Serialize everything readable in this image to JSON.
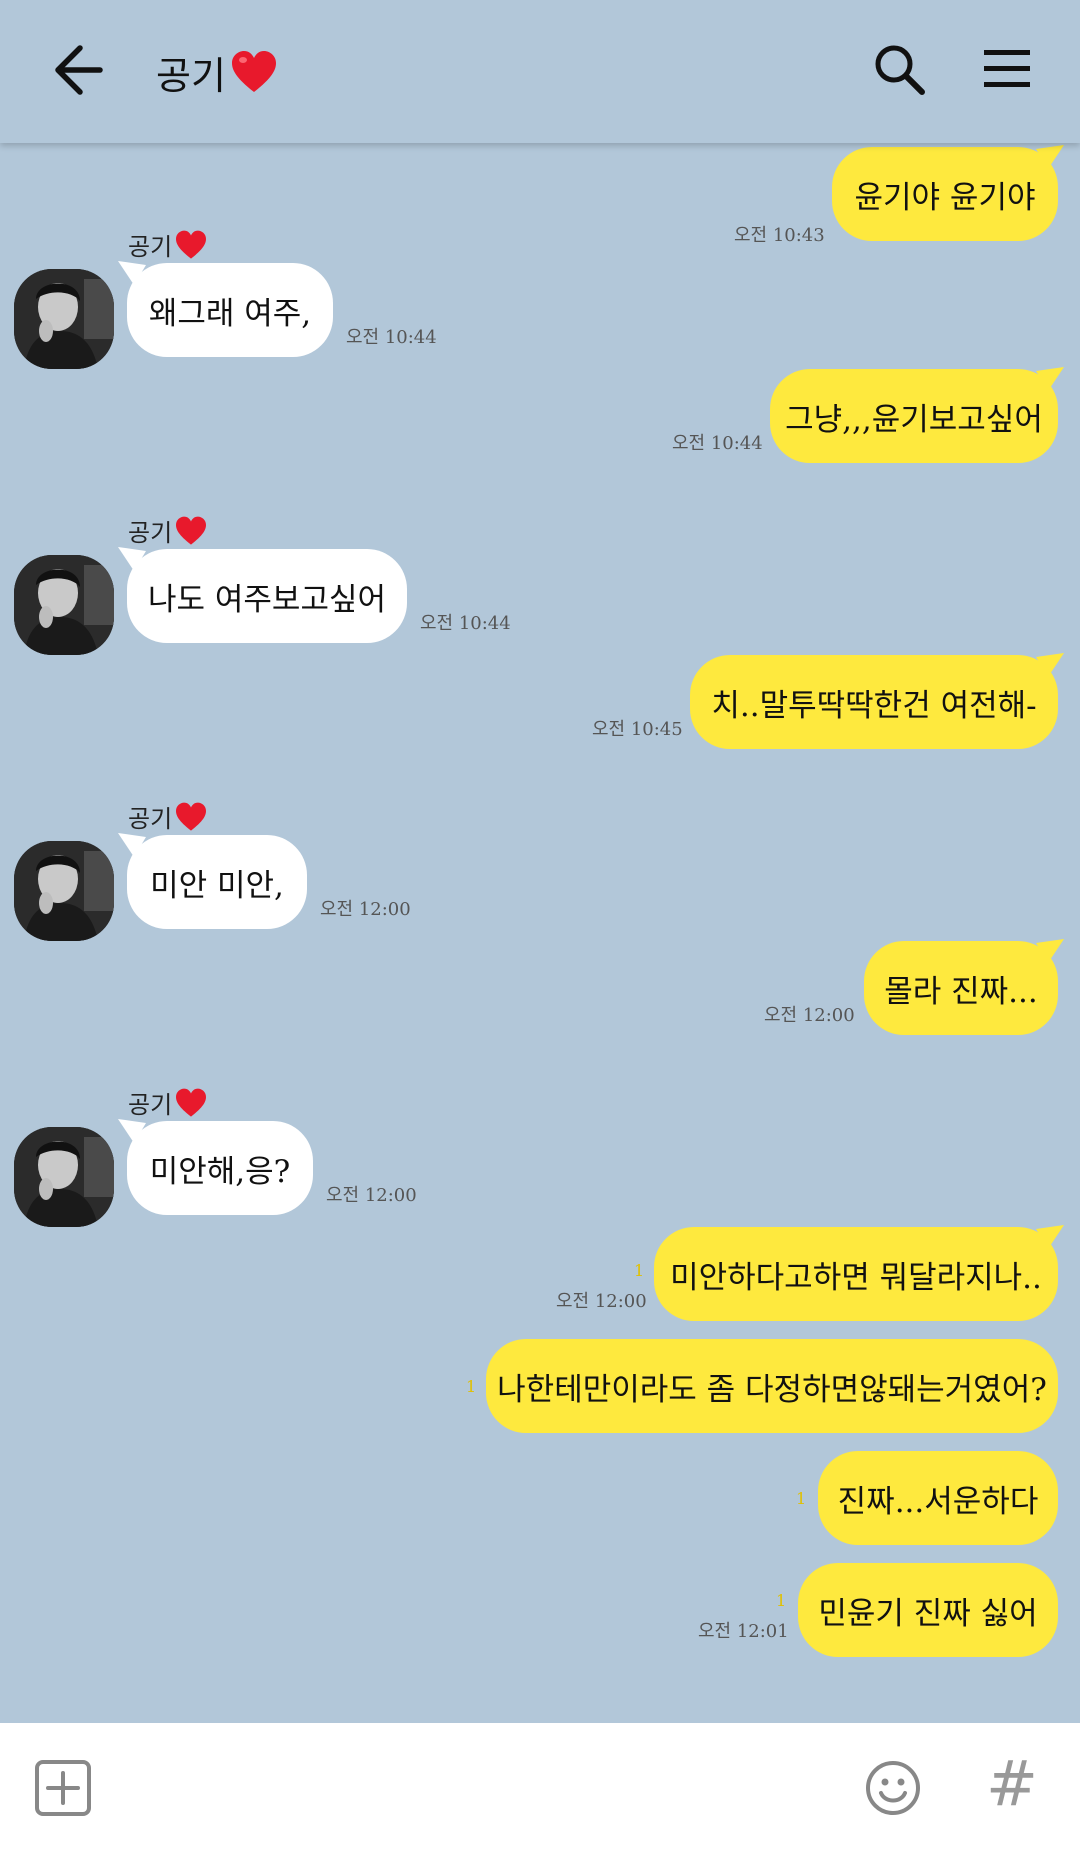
{
  "header": {
    "title": "공기"
  },
  "messages": [
    {
      "text": "윤기야 윤기야",
      "time": "오전 10:43",
      "unread": ""
    },
    {
      "sender": "공기",
      "text": "왜그래 여주,",
      "time": "오전 10:44"
    },
    {
      "text": "그냥,,,윤기보고싶어",
      "time": "오전 10:44",
      "unread": ""
    },
    {
      "sender": "공기",
      "text": "나도 여주보고싶어",
      "time": "오전 10:44"
    },
    {
      "text": "치..말투딱딱한건 여전해-",
      "time": "오전 10:45",
      "unread": ""
    },
    {
      "sender": "공기",
      "text": "미안 미안,",
      "time": "오전 12:00"
    },
    {
      "text": "몰라 진짜...",
      "time": "오전 12:00",
      "unread": ""
    },
    {
      "sender": "공기",
      "text": "미안해,응?",
      "time": "오전 12:00"
    },
    {
      "text": "미안하다고하면 뭐달라지나..",
      "time": "오전 12:00",
      "unread": "1"
    },
    {
      "text": "나한테만이라도 좀 다정하면않돼는거였어?",
      "time": "",
      "unread": "1"
    },
    {
      "text": "진짜...서운하다",
      "time": "",
      "unread": "1"
    },
    {
      "text": "민윤기 진짜 싫어",
      "time": "오전 12:01",
      "unread": "1"
    }
  ],
  "icons": {
    "back": "arrow-left-icon",
    "search": "search-icon",
    "menu": "hamburger-menu-icon",
    "plus": "plus-box-icon",
    "emoji": "smiley-icon",
    "hash": "#"
  },
  "colors": {
    "background": "#b2c7d9",
    "my_bubble": "#fee93e",
    "their_bubble": "#ffffff",
    "heart": "#e8192c",
    "unread": "#e0c000"
  }
}
